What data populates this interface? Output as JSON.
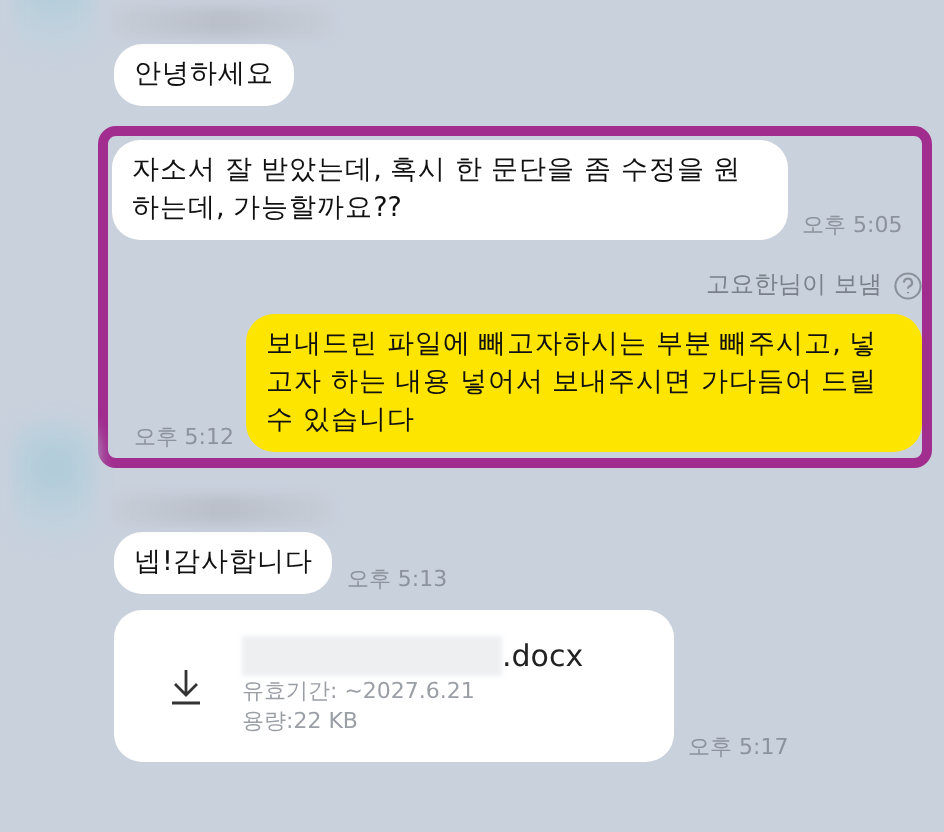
{
  "blocks": [
    {
      "kind": "sender"
    },
    {
      "kind": "received",
      "text": "안녕하세요"
    },
    {
      "kind": "highlight",
      "items": [
        {
          "kind": "received",
          "text": "자소서 잘 받았는데, 혹시 한 문단을 좀 수정을 원하는데, 가능할까요??",
          "time": "오후 5:05"
        },
        {
          "kind": "sent_by",
          "text": "고요한님이 보냄"
        },
        {
          "kind": "sent",
          "text": "보내드린 파일에 빼고자하시는 부분 빼주시고, 넣고자 하는 내용 넣어서 보내주시면 가다듬어 드릴 수 있습니다",
          "time": "오후 5:12"
        }
      ]
    },
    {
      "kind": "sender"
    },
    {
      "kind": "received",
      "text": "넵!감사합니다",
      "time": "오후 5:13"
    },
    {
      "kind": "file",
      "name": ".docx",
      "expiry": "유효기간: ~2027.6.21",
      "size": "용량:22 KB",
      "time": "오후 5:17"
    }
  ]
}
